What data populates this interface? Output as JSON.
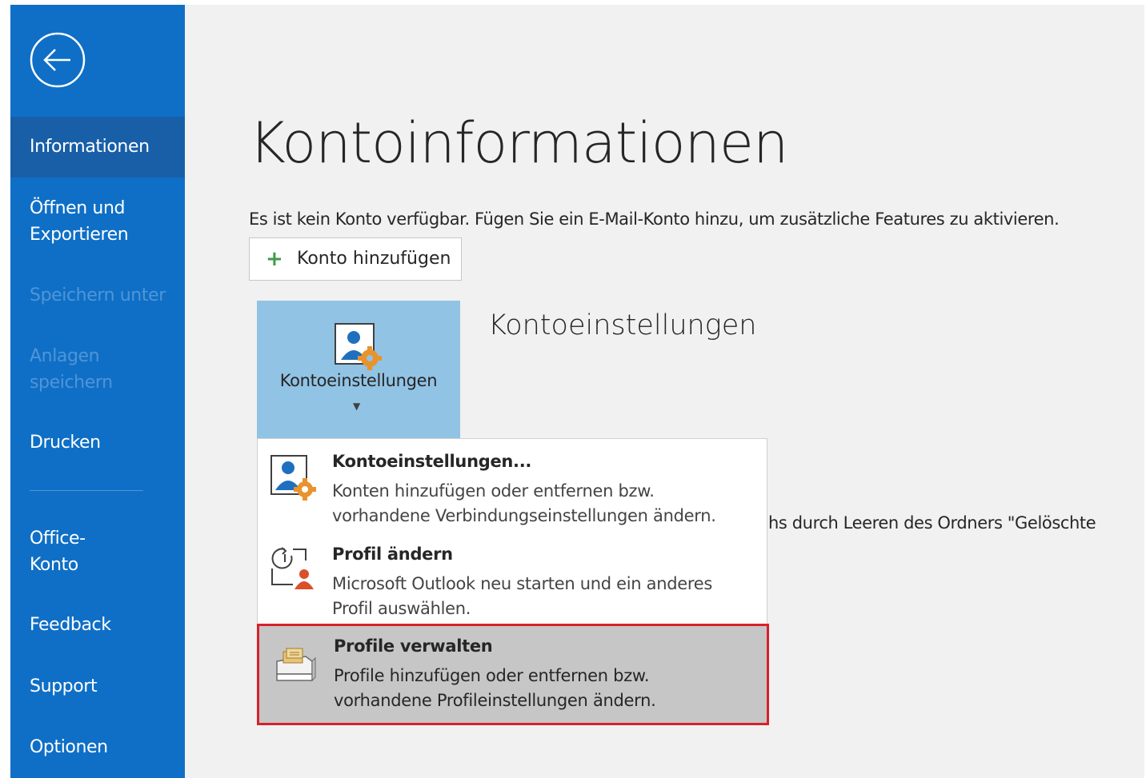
{
  "nav": {
    "items": [
      {
        "label": "Informationen",
        "state": "active"
      },
      {
        "label": "Öffnen und Exportieren",
        "state": "normal"
      },
      {
        "label": "Speichern unter",
        "state": "disabled"
      },
      {
        "label": "Anlagen speichern",
        "state": "disabled"
      },
      {
        "label": "Drucken",
        "state": "normal"
      },
      {
        "label": "Office-Konto",
        "state": "normal"
      },
      {
        "label": "Feedback",
        "state": "normal"
      },
      {
        "label": "Support",
        "state": "normal"
      },
      {
        "label": "Optionen",
        "state": "normal"
      }
    ],
    "back_icon": "back-arrow-icon"
  },
  "main": {
    "title": "Kontoinformationen",
    "info_text": "Es ist kein Konto verfügbar. Fügen Sie ein E-Mail-Konto hinzu, um zusätzliche Features zu aktivieren.",
    "add_account_label": "Konto hinzufügen",
    "account_settings_button_label": "Kontoeinstellungen",
    "section_title": "Kontoeinstellungen",
    "background_text": "hs durch Leeren des Ordners \"Gelöschte",
    "background_text_tiny": ")"
  },
  "dropdown": {
    "items": [
      {
        "title": "Kontoeinstellungen...",
        "description": "Konten hinzufügen oder entfernen bzw. vorhandene Verbindungseinstellungen ändern.",
        "icon": "account-settings-icon",
        "highlighted": false
      },
      {
        "title": "Profil ändern",
        "description": "Microsoft Outlook neu starten und ein anderes Profil auswählen.",
        "icon": "change-profile-icon",
        "highlighted": false
      },
      {
        "title": "Profile verwalten",
        "description": "Profile hinzufügen oder entfernen bzw. vorhandene Profileinstellungen ändern.",
        "icon": "manage-profiles-icon",
        "highlighted": true
      }
    ]
  },
  "colors": {
    "sidebar": "#0f6fc6",
    "sidebar_active": "#185fa8",
    "highlight_border": "#d9202a",
    "tile": "#91c3e4"
  }
}
